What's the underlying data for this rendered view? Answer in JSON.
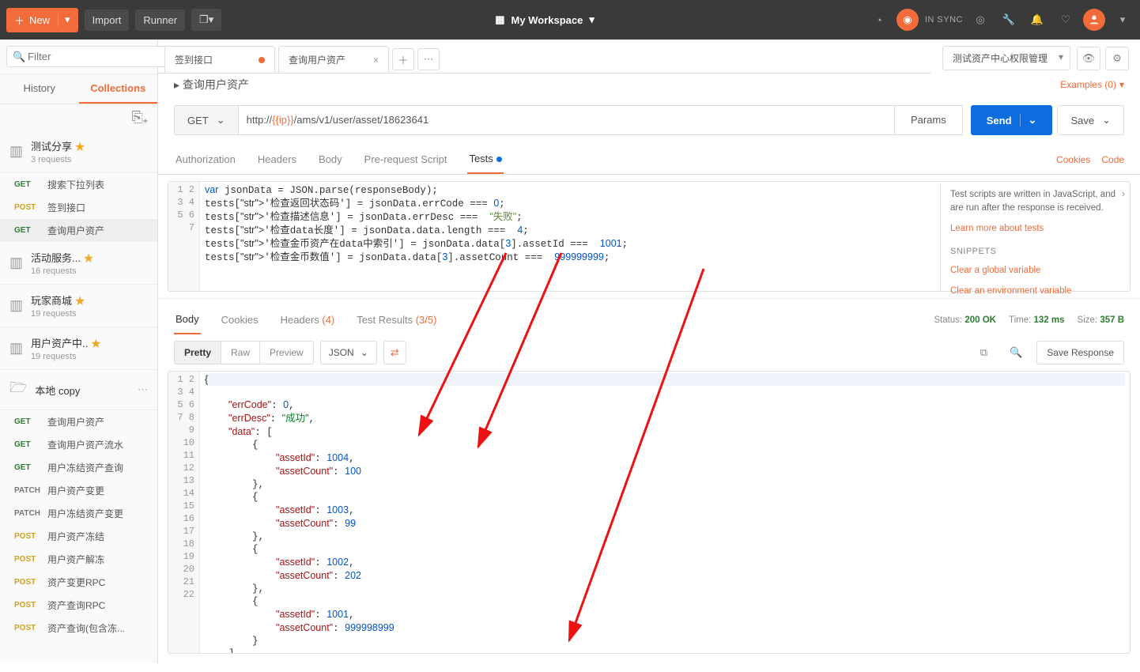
{
  "toolbar": {
    "new": "New",
    "import": "Import",
    "runner": "Runner",
    "workspace": "My Workspace",
    "sync": "IN SYNC"
  },
  "sidebar": {
    "filter_placeholder": "Filter",
    "tabs": {
      "history": "History",
      "collections": "Collections"
    },
    "collections": [
      {
        "name": "测试分享",
        "sub": "3 requests",
        "starred": true
      },
      {
        "name": "活动服务...",
        "sub": "16 requests",
        "starred": true
      },
      {
        "name": "玩家商城",
        "sub": "19 requests",
        "starred": true
      },
      {
        "name": "用户资产中..",
        "sub": "19 requests",
        "starred": true
      }
    ],
    "loose_requests": [
      {
        "method": "GET",
        "name": "搜索下拉列表"
      },
      {
        "method": "POST",
        "name": "签到接口"
      },
      {
        "method": "GET",
        "name": "查询用户资产",
        "active": true
      }
    ],
    "local_folder": {
      "name": "本地 copy",
      "items": [
        {
          "method": "GET",
          "name": "查询用户资产"
        },
        {
          "method": "GET",
          "name": "查询用户资产流水"
        },
        {
          "method": "GET",
          "name": "用户冻结资产查询"
        },
        {
          "method": "PATCH",
          "name": "用户资产变更"
        },
        {
          "method": "PATCH",
          "name": "用户冻结资产变更"
        },
        {
          "method": "POST",
          "name": "用户资产冻结"
        },
        {
          "method": "POST",
          "name": "用户资产解冻"
        },
        {
          "method": "POST",
          "name": "资产变更RPC"
        },
        {
          "method": "POST",
          "name": "资产查询RPC"
        },
        {
          "method": "POST",
          "name": "资产查询(包含冻..."
        }
      ]
    }
  },
  "tabs": [
    {
      "label": "签到接口",
      "dirty": true
    },
    {
      "label": "查询用户资产",
      "closable": true
    }
  ],
  "environment": "测试资产中心权限管理",
  "breadcrumb": "查询用户资产",
  "examples": "Examples (0)",
  "request": {
    "method": "GET",
    "url_prefix": "http://",
    "url_var": "{{ip}}",
    "url_suffix": "/ams/v1/user/asset/18623641",
    "params": "Params",
    "send": "Send",
    "save": "Save",
    "section_tabs": {
      "authorization": "Authorization",
      "headers": "Headers",
      "body": "Body",
      "prerequest": "Pre-request Script",
      "tests": "Tests"
    }
  },
  "tests_panel": {
    "info": "Test scripts are written in JavaScript, and are run after the response is received.",
    "learn": "Learn more about tests",
    "snippets_hd": "SNIPPETS",
    "snippet1": "Clear a global variable",
    "snippet2": "Clear an environment variable"
  },
  "tests_code": [
    "var jsonData = JSON.parse(responseBody);",
    "tests['检查返回状态码'] = jsonData.errCode === 0;",
    "tests['检查描述信息'] = jsonData.errDesc ===  \"失败\";",
    "tests['检查data长度'] = jsonData.data.length ===  4;",
    "tests['检查金币资产在data中索引'] = jsonData.data[3].assetId ===  1001;",
    "tests['检查金币数值'] = jsonData.data[3].assetCount ===  999999999;"
  ],
  "response": {
    "tabs": {
      "body": "Body",
      "cookies": "Cookies",
      "headers": "Headers",
      "headers_count": "(4)",
      "test_results": "Test Results",
      "tr_count": "(3/5)"
    },
    "status_label": "Status:",
    "status_value": "200 OK",
    "time_label": "Time:",
    "time_value": "132 ms",
    "size_label": "Size:",
    "size_value": "357 B",
    "view": {
      "pretty": "Pretty",
      "raw": "Raw",
      "preview": "Preview",
      "format": "JSON"
    },
    "save_response": "Save Response",
    "links": {
      "cookies": "Cookies",
      "code": "Code"
    }
  },
  "response_json": {
    "errCode": 0,
    "errDesc": "成功",
    "data": [
      {
        "assetId": 1004,
        "assetCount": 100
      },
      {
        "assetId": 1003,
        "assetCount": 99
      },
      {
        "assetId": 1002,
        "assetCount": 202
      },
      {
        "assetId": 1001,
        "assetCount": 999998999
      }
    ]
  }
}
